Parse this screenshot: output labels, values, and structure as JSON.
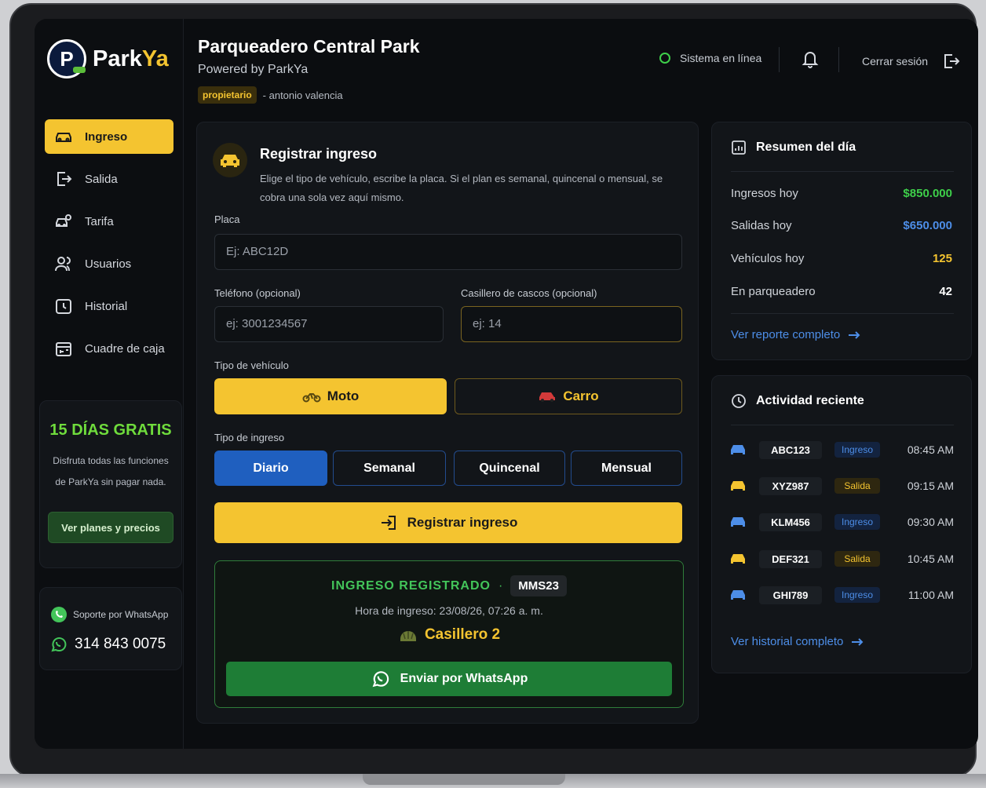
{
  "brand": {
    "name_a": "Park",
    "name_b": "Ya",
    "badge_letter": "P"
  },
  "sidebar": {
    "items": [
      {
        "label": "Ingreso",
        "icon": "car-icon"
      },
      {
        "label": "Salida",
        "icon": "exit-icon"
      },
      {
        "label": "Tarifa",
        "icon": "coins-icon"
      },
      {
        "label": "Usuarios",
        "icon": "users-icon"
      },
      {
        "label": "Historial",
        "icon": "clock-icon"
      },
      {
        "label": "Cuadre de caja",
        "icon": "cashbox-icon"
      }
    ],
    "promo": {
      "title": "15 DÍAS GRATIS",
      "desc": "Disfruta todas las funciones de ParkYa sin pagar nada.",
      "button": "Ver planes y precios"
    },
    "support": {
      "label": "Soporte por WhatsApp",
      "phone": "314 843 0075"
    }
  },
  "header": {
    "title": "Parqueadero Central Park",
    "subtitle": "Powered by ParkYa",
    "role": "propietario",
    "user": "- antonio valencia",
    "status": "Sistema en línea",
    "logout": "Cerrar sesión"
  },
  "form": {
    "title": "Registrar ingreso",
    "desc": "Elige el tipo de vehículo, escribe la placa. Si el plan es semanal, quincenal o mensual, se cobra una sola vez aquí mismo.",
    "plate_label": "Placa",
    "plate_placeholder": "Ej: ABC12D",
    "phone_label": "Teléfono (opcional)",
    "phone_placeholder": "ej: 3001234567",
    "locker_label": "Casillero de cascos (opcional)",
    "locker_placeholder": "ej: 14",
    "vehicle_label": "Tipo de vehículo",
    "vehicle_moto": "Moto",
    "vehicle_carro": "Carro",
    "entry_label": "Tipo de ingreso",
    "entry_types": [
      "Diario",
      "Semanal",
      "Quincenal",
      "Mensual"
    ],
    "submit": "Registrar ingreso"
  },
  "result": {
    "title": "INGRESO REGISTRADO",
    "sep": "·",
    "plate": "MMS23",
    "time": "Hora de ingreso: 23/08/26, 07:26 a. m.",
    "locker": "Casillero 2",
    "whatsapp": "Enviar por WhatsApp"
  },
  "summary": {
    "title": "Resumen del día",
    "rows": [
      {
        "label": "Ingresos hoy",
        "value": "$850.000",
        "color": "#3ecf4a"
      },
      {
        "label": "Salidas hoy",
        "value": "$650.000",
        "color": "#4d8ee8"
      },
      {
        "label": "Vehículos hoy",
        "value": "125",
        "color": "#f4c430"
      },
      {
        "label": "En parqueadero",
        "value": "42",
        "color": "#ffffff"
      }
    ],
    "link": "Ver reporte completo"
  },
  "activity": {
    "title": "Actividad reciente",
    "rows": [
      {
        "plate": "ABC123",
        "type": "Ingreso",
        "time": "08:45 AM",
        "color": "#4d8ee8"
      },
      {
        "plate": "XYZ987",
        "type": "Salida",
        "time": "09:15 AM",
        "color": "#f4c430"
      },
      {
        "plate": "KLM456",
        "type": "Ingreso",
        "time": "09:30 AM",
        "color": "#4d8ee8"
      },
      {
        "plate": "DEF321",
        "type": "Salida",
        "time": "10:45 AM",
        "color": "#f4c430"
      },
      {
        "plate": "GHI789",
        "type": "Ingreso",
        "time": "11:00 AM",
        "color": "#4d8ee8"
      }
    ],
    "link": "Ver historial completo"
  }
}
